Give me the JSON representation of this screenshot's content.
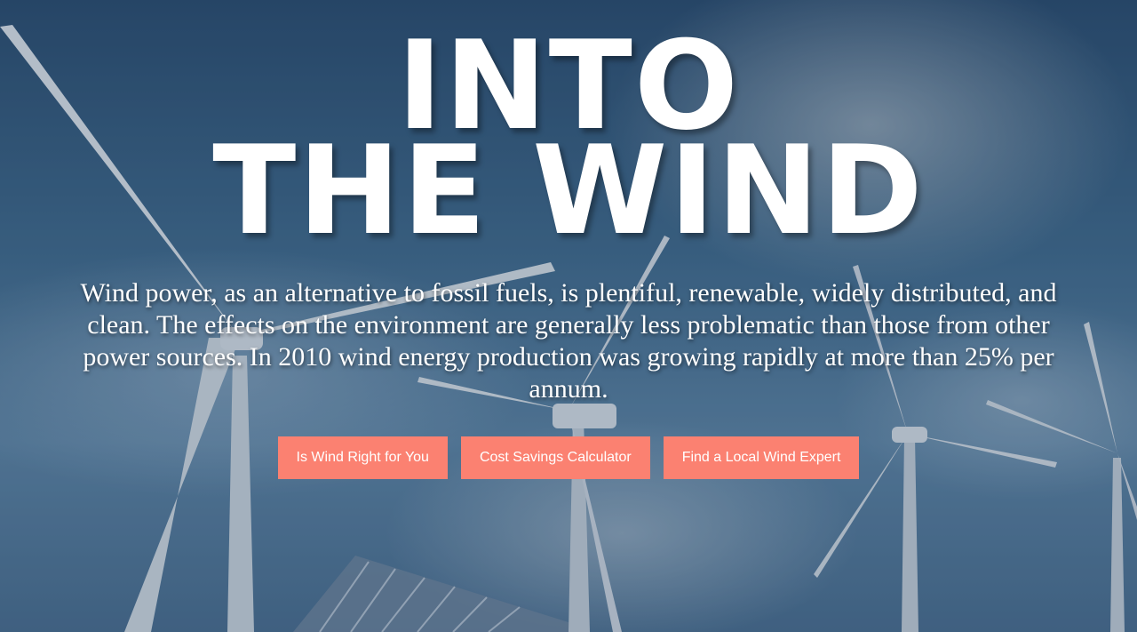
{
  "hero": {
    "title_line1": "INTO",
    "title_line2": "THE WIND",
    "description": "Wind power, as an alternative to fossil fuels, is plentiful, renewable, widely distributed, and clean. The effects on the environment are generally less problematic than those from other power sources. In 2010 wind energy production was growing rapidly at more than 25% per annum."
  },
  "buttons": [
    {
      "label": "Is Wind Right for You"
    },
    {
      "label": "Cost Savings Calculator"
    },
    {
      "label": "Find a Local Wind Expert"
    }
  ],
  "colors": {
    "button_background": "#fb8171",
    "text": "#ffffff",
    "sky_tint": "#3e6688"
  }
}
